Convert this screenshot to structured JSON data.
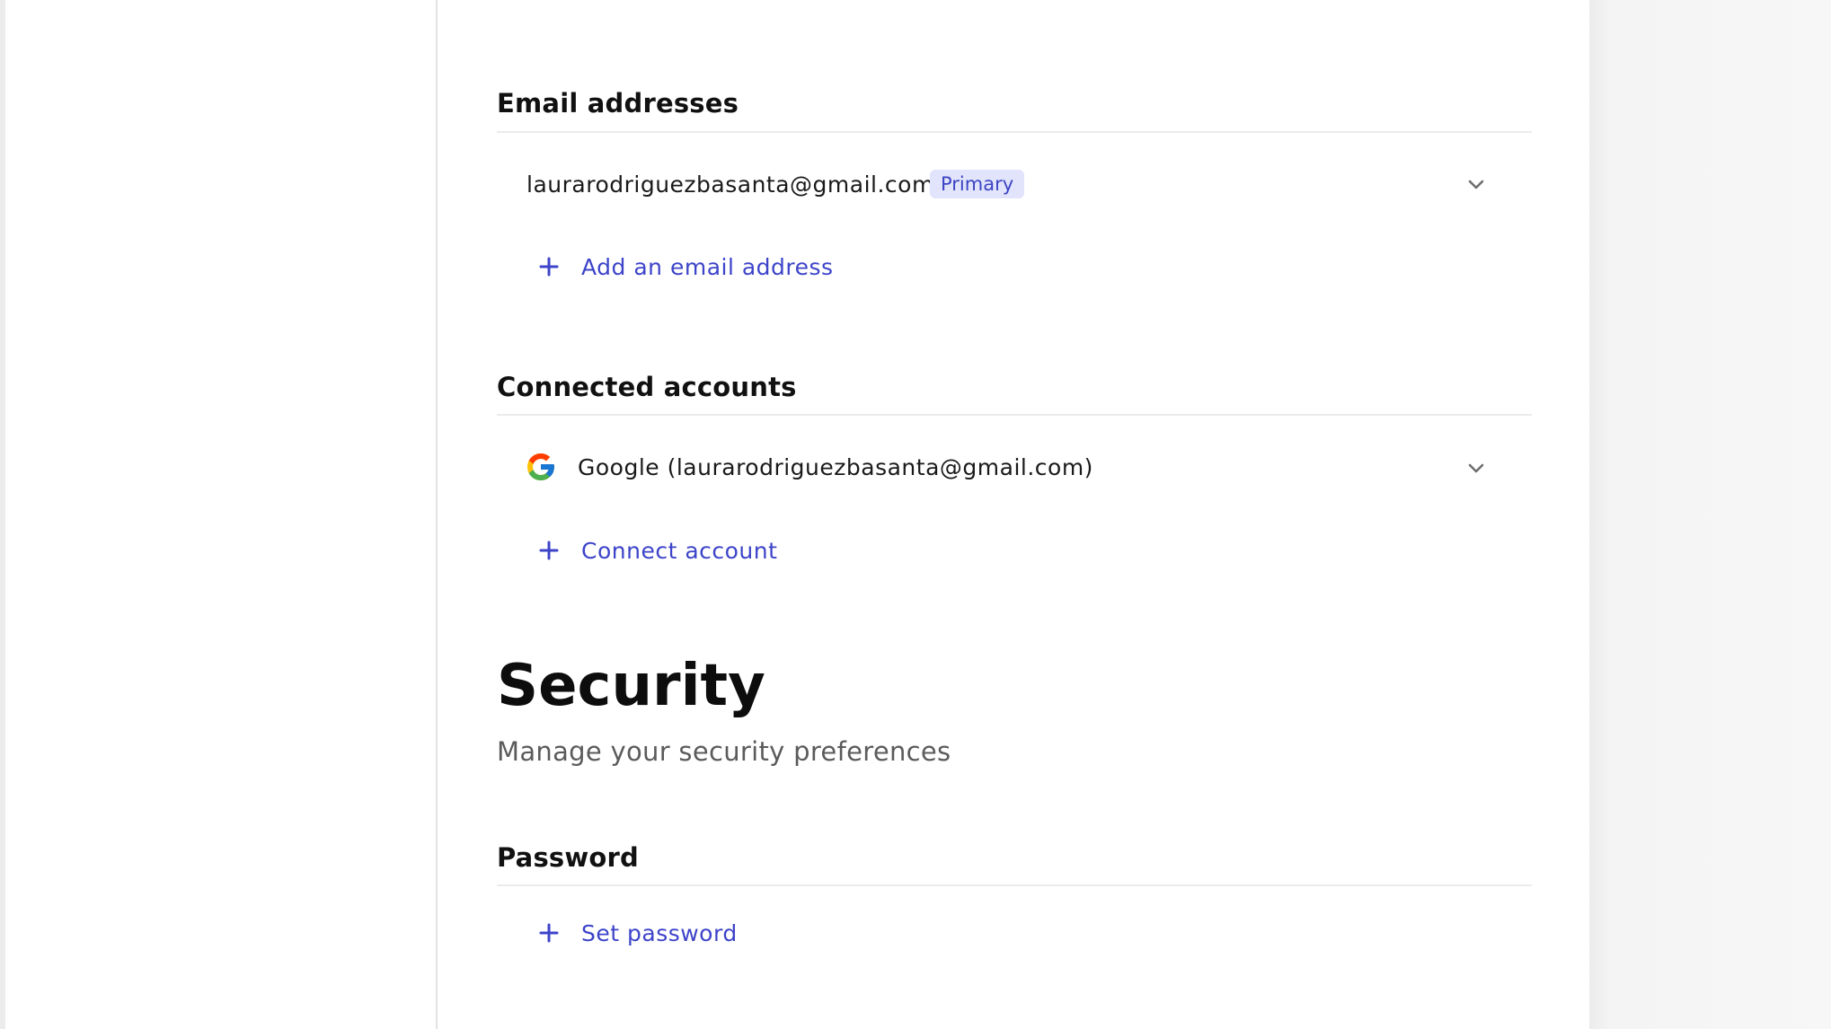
{
  "email_section": {
    "title": "Email addresses",
    "items": [
      {
        "email": "laurarodriguezbasanta@gmail.com",
        "badge": "Primary"
      }
    ],
    "add_label": "Add an email address"
  },
  "connected_section": {
    "title": "Connected accounts",
    "items": [
      {
        "provider_icon": "google-icon",
        "label": "Google (laurarodriguezbasanta@gmail.com)"
      }
    ],
    "add_label": "Connect account"
  },
  "security": {
    "title": "Security",
    "subtitle": "Manage your security preferences"
  },
  "password_section": {
    "title": "Password",
    "add_label": "Set password"
  },
  "colors": {
    "accent": "#3d44c9",
    "badge_bg": "#e2e4fb",
    "badge_text": "#3b42c4",
    "divider": "#ebebeb"
  }
}
